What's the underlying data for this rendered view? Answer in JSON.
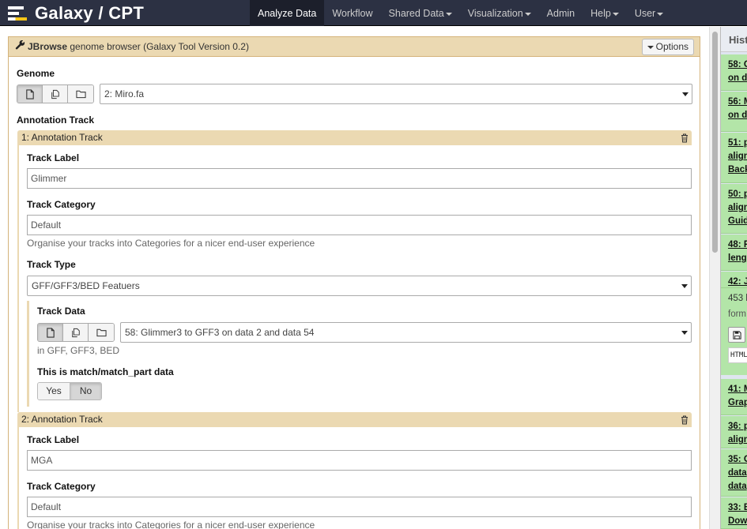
{
  "app": {
    "title": "Galaxy / CPT"
  },
  "nav": [
    {
      "label": "Analyze Data",
      "active": true,
      "dropdown": false
    },
    {
      "label": "Workflow",
      "active": false,
      "dropdown": false
    },
    {
      "label": "Shared Data",
      "active": false,
      "dropdown": true
    },
    {
      "label": "Visualization",
      "active": false,
      "dropdown": true
    },
    {
      "label": "Admin",
      "active": false,
      "dropdown": false
    },
    {
      "label": "Help",
      "active": false,
      "dropdown": true
    },
    {
      "label": "User",
      "active": false,
      "dropdown": true
    }
  ],
  "tool": {
    "name": "JBrowse",
    "description": "genome browser (Galaxy Tool Version 0.2)",
    "options_label": "Options"
  },
  "genome": {
    "label": "Genome",
    "value": "2: Miro.fa"
  },
  "annotation_track": {
    "label": "Annotation Track"
  },
  "tracks": [
    {
      "header": "1: Annotation Track",
      "track_label_label": "Track Label",
      "track_label_value": "Glimmer",
      "track_category_label": "Track Category",
      "track_category_value": "Default",
      "track_category_help": "Organise your tracks into Categories for a nicer end-user experience",
      "track_type_label": "Track Type",
      "track_type_value": "GFF/GFF3/BED Featuers",
      "track_data_label": "Track Data",
      "track_data_value": "58: Glimmer3 to GFF3 on data 2 and data 54",
      "track_data_help": "in GFF, GFF3, BED",
      "match_label": "This is match/match_part data",
      "match_yes": "Yes",
      "match_no": "No",
      "match_selected": "No"
    },
    {
      "header": "2: Annotation Track",
      "track_label_label": "Track Label",
      "track_label_value": "MGA",
      "track_category_label": "Track Category",
      "track_category_value": "Default",
      "track_category_help": "Organise your tracks into Categories for a nicer end-user experience"
    }
  ],
  "history": {
    "title": "Hist",
    "items": [
      {
        "lines": [
          "58: G",
          "on da"
        ]
      },
      {
        "lines": [
          "56: M",
          "on da"
        ]
      },
      {
        "lines": [
          "51: p",
          "align",
          "Back"
        ]
      },
      {
        "lines": [
          "50: p",
          "align",
          "Guid"
        ]
      },
      {
        "lines": [
          "48: F",
          "leng"
        ]
      },
      {
        "lines": [
          "42: J"
        ]
      },
      {
        "lines": [
          "41: M",
          "Grap"
        ]
      },
      {
        "lines": [
          "36: p",
          "align"
        ]
      },
      {
        "lines": [
          "35: C",
          "data",
          "data"
        ]
      },
      {
        "lines": [
          "33: B",
          "Dow"
        ]
      }
    ],
    "expanded": {
      "info1": "453 l",
      "info2": "form",
      "peek": "HTML"
    }
  },
  "icons": {
    "logo": "galaxy-logo",
    "wrench": "wrench-icon",
    "file": "file-icon",
    "files": "multiple-files-icon",
    "folder": "folder-icon",
    "trash": "trash-icon",
    "save": "save-icon"
  },
  "colors": {
    "navbar": "#2c3143",
    "form_header": "#ebd9b2",
    "history_ok": "#b3e5a8"
  }
}
